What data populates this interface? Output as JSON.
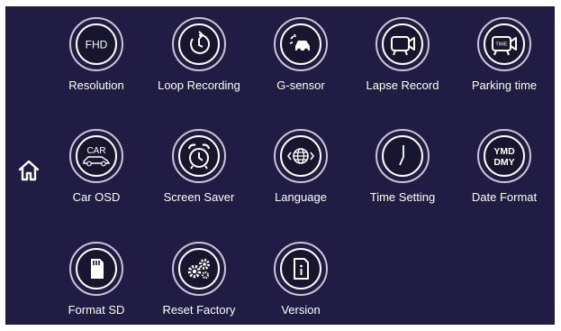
{
  "colors": {
    "screen_background": "#211c44",
    "icon_disc": "#18152e",
    "ring": "#c9c6d2",
    "text": "#ffffff"
  },
  "home": {
    "icon": "home-icon"
  },
  "menu": {
    "items": [
      {
        "label": "Resolution",
        "icon": "fhd-icon",
        "icon_text": "FHD"
      },
      {
        "label": "Loop Recording",
        "icon": "loop-clock-icon"
      },
      {
        "label": "G-sensor",
        "icon": "car-collision-icon"
      },
      {
        "label": "Lapse Record",
        "icon": "video-camera-icon"
      },
      {
        "label": "Parking time",
        "icon": "parking-camera-icon",
        "icon_text": "TIME"
      },
      {
        "label": "Car OSD",
        "icon": "car-osd-icon",
        "icon_text": "CAR"
      },
      {
        "label": "Screen Saver",
        "icon": "alarm-clock-icon"
      },
      {
        "label": "Language",
        "icon": "globe-icon"
      },
      {
        "label": "Time Setting",
        "icon": "clock-icon"
      },
      {
        "label": "Date Format",
        "icon": "date-format-icon",
        "icon_text": "YMD",
        "icon_text_2": "DMY"
      },
      {
        "label": "Format SD",
        "icon": "sd-card-icon"
      },
      {
        "label": "Reset Factory",
        "icon": "gears-icon"
      },
      {
        "label": "Version",
        "icon": "info-document-icon"
      }
    ]
  }
}
